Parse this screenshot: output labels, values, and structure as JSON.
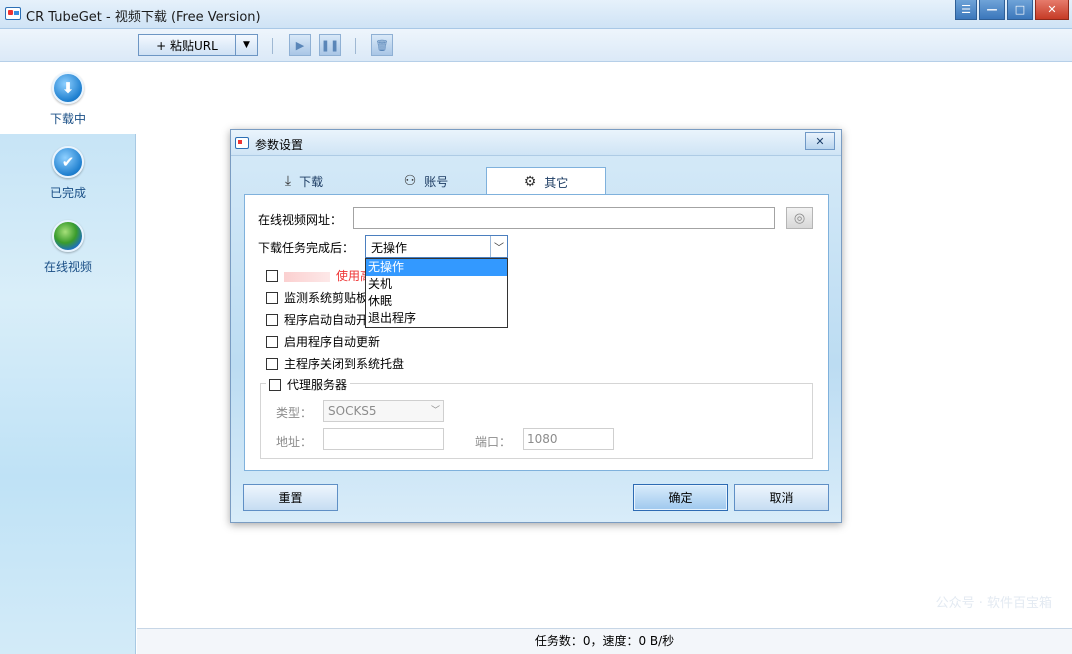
{
  "app": {
    "title": "CR TubeGet - 视频下载 (Free Version)"
  },
  "window_buttons": {
    "menu": "☰",
    "minimize": "—",
    "maximize": "□",
    "close": "✕"
  },
  "toolbar": {
    "paste_url": "+ 粘贴URL",
    "dropdown": "▼",
    "play": "▶",
    "pause": "❚❚",
    "delete": "🗑"
  },
  "sidebar": {
    "items": [
      {
        "label": "下载中",
        "icon": "download-icon",
        "glyph": "⬇"
      },
      {
        "label": "已完成",
        "icon": "check-icon",
        "glyph": "✔"
      },
      {
        "label": "在线视频",
        "icon": "globe-icon",
        "glyph": ""
      }
    ]
  },
  "status": {
    "text": "任务数：0，速度：0 B/秒"
  },
  "watermark": "公众号 · 软件百宝箱",
  "dialog": {
    "title": "参数设置",
    "close": "✕",
    "tabs": [
      {
        "label": "下载",
        "icon": "download-tab-icon",
        "glyph": "⤓"
      },
      {
        "label": "账号",
        "icon": "user-icon",
        "glyph": "⚇"
      },
      {
        "label": "其它",
        "icon": "gear-icon",
        "glyph": "⚙"
      }
    ],
    "online_url_label": "在线视频网址：",
    "online_url_value": "",
    "globe_btn": "◎",
    "after_complete_label": "下载任务完成后：",
    "after_complete_value": "无操作",
    "after_complete_options": [
      "无操作",
      "关机",
      "休眠",
      "退出程序"
    ],
    "checkboxes": [
      "使用高",
      "监测系统剪贴板",
      "程序启动自动开",
      "启用程序自动更新",
      "主程序关闭到系统托盘"
    ],
    "proxy": {
      "label": "代理服务器",
      "type_label": "类型：",
      "type_value": "SOCKS5",
      "address_label": "地址：",
      "address_value": "",
      "port_label": "端口：",
      "port_value": "1080"
    },
    "reset": "重置",
    "ok": "确定",
    "cancel": "取消"
  }
}
